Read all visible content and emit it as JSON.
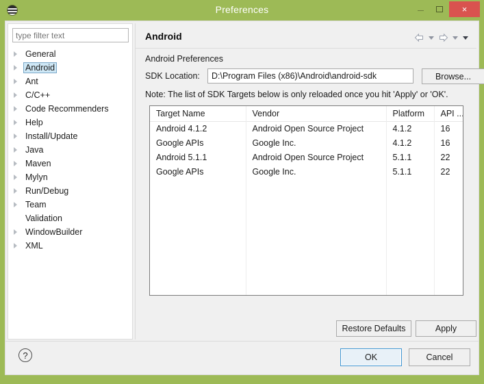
{
  "window": {
    "title": "Preferences",
    "icon": "eclipse-circle-icon",
    "frame_color": "#9dba56",
    "controls": {
      "minimize": "minimize-icon",
      "maximize": "maximize-icon",
      "close": "×",
      "close_color": "#d9534f"
    }
  },
  "sidebar": {
    "filter": {
      "value": "",
      "placeholder": "type filter text"
    },
    "selected": "Android",
    "selection_color": "#cfe8f6",
    "items": [
      {
        "label": "General",
        "expandable": true
      },
      {
        "label": "Android",
        "expandable": true
      },
      {
        "label": "Ant",
        "expandable": true
      },
      {
        "label": "C/C++",
        "expandable": true
      },
      {
        "label": "Code Recommenders",
        "expandable": true
      },
      {
        "label": "Help",
        "expandable": true
      },
      {
        "label": "Install/Update",
        "expandable": true
      },
      {
        "label": "Java",
        "expandable": true
      },
      {
        "label": "Maven",
        "expandable": true
      },
      {
        "label": "Mylyn",
        "expandable": true
      },
      {
        "label": "Run/Debug",
        "expandable": true
      },
      {
        "label": "Team",
        "expandable": true
      },
      {
        "label": "Validation",
        "expandable": false
      },
      {
        "label": "WindowBuilder",
        "expandable": true
      },
      {
        "label": "XML",
        "expandable": true
      }
    ]
  },
  "page": {
    "title": "Android",
    "nav": {
      "back": "back-arrow-icon",
      "back_menu": "chevron-down-icon",
      "forward": "forward-arrow-icon",
      "forward_menu": "chevron-down-icon",
      "view_menu": "chevron-down-icon"
    },
    "section_label": "Android Preferences",
    "sdk": {
      "label": "SDK Location:",
      "value": "D:\\Program Files (x86)\\Android\\android-sdk",
      "placeholder": "",
      "browse_label": "Browse..."
    },
    "note": "Note: The list of SDK Targets below is only reloaded once you hit 'Apply' or 'OK'.",
    "table": {
      "columns": [
        "Target Name",
        "Vendor",
        "Platform",
        "API ..."
      ],
      "rows": [
        [
          "Android 4.1.2",
          "Android Open Source Project",
          "4.1.2",
          "16"
        ],
        [
          "Google APIs",
          "Google Inc.",
          "4.1.2",
          "16"
        ],
        [
          "Android 5.1.1",
          "Android Open Source Project",
          "5.1.1",
          "22"
        ],
        [
          "Google APIs",
          "Google Inc.",
          "5.1.1",
          "22"
        ]
      ]
    },
    "restore_defaults_label": "Restore Defaults",
    "apply_label": "Apply"
  },
  "footer": {
    "help_icon": "?",
    "ok_label": "OK",
    "cancel_label": "Cancel",
    "ok_focus_color": "#3d94d1"
  }
}
